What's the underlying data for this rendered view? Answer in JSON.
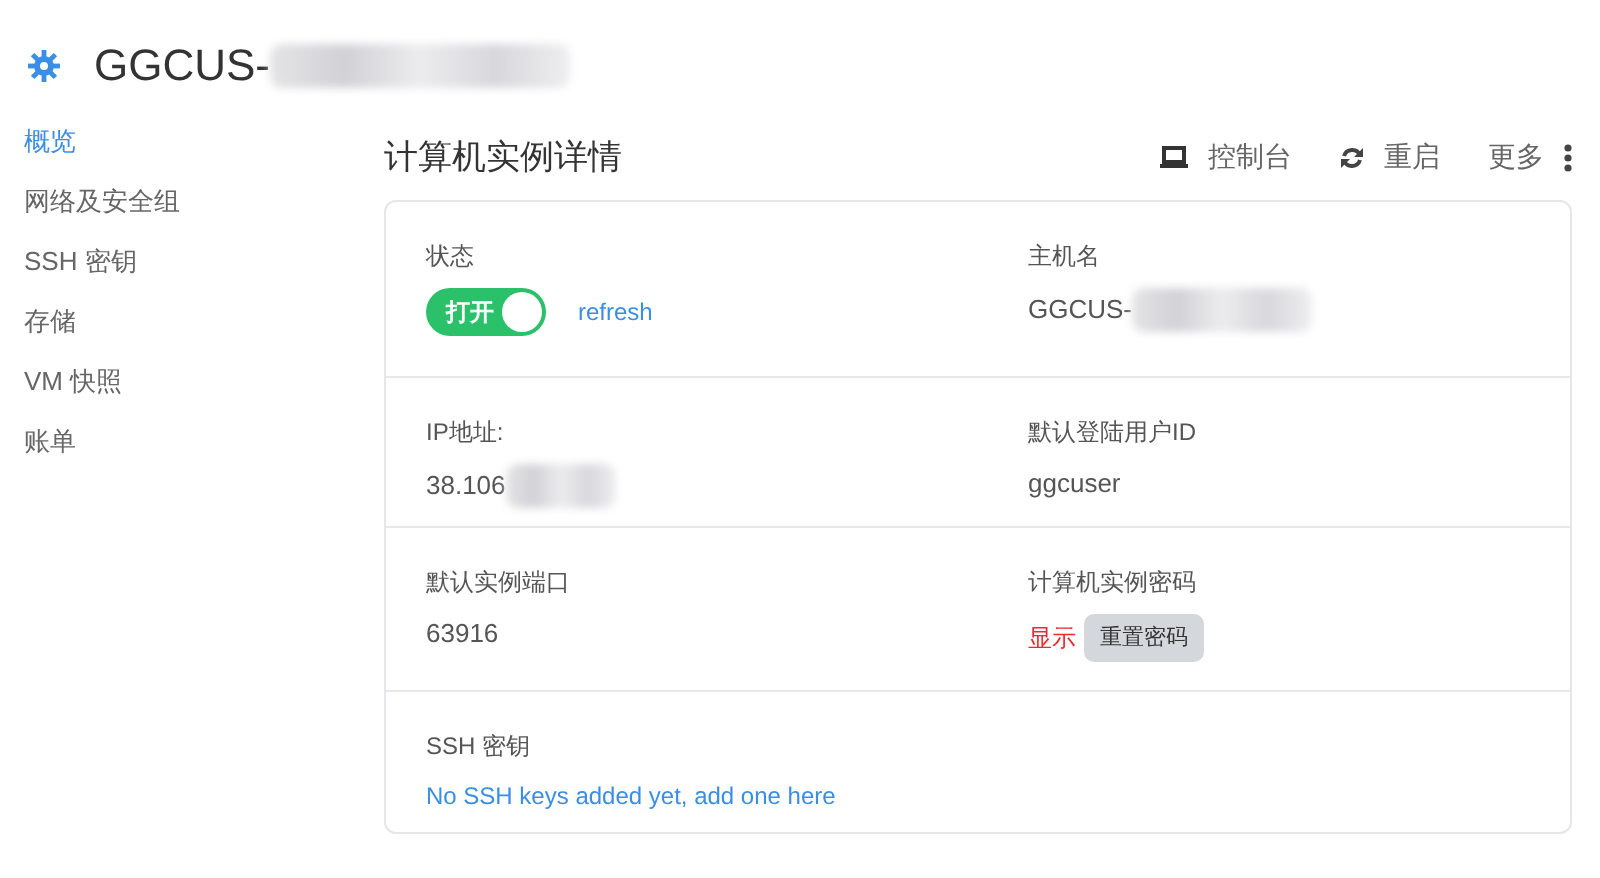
{
  "header": {
    "title": "GGCUS-",
    "redacted": true
  },
  "sidebar": {
    "items": [
      {
        "label": "概览",
        "selected": true
      },
      {
        "label": "网络及安全组",
        "selected": false
      },
      {
        "label": "SSH 密钥",
        "selected": false
      },
      {
        "label": "存储",
        "selected": false
      },
      {
        "label": "VM 快照",
        "selected": false
      },
      {
        "label": "账单",
        "selected": false
      }
    ]
  },
  "main": {
    "title": "计算机实例详情",
    "actions": [
      {
        "kind": "console",
        "label": "控制台"
      },
      {
        "kind": "restart",
        "label": "重启"
      },
      {
        "kind": "more",
        "label": "更多"
      }
    ]
  },
  "rows": [
    {
      "cells": [
        {
          "kind": "status",
          "label": "状态",
          "toggle_label": "打开",
          "on": true,
          "link": "refresh"
        },
        {
          "kind": "text",
          "label": "主机名",
          "value": "GGCUS-",
          "redacted": true
        }
      ]
    },
    {
      "cells": [
        {
          "kind": "text",
          "label": "IP地址:",
          "value": "38.106",
          "redacted": true
        },
        {
          "kind": "text",
          "label": "默认登陆用户ID",
          "value": "ggcuser",
          "redacted": false
        }
      ]
    },
    {
      "cells": [
        {
          "kind": "text",
          "label": "默认实例端口",
          "value": "63916",
          "redacted": false
        },
        {
          "kind": "password",
          "label": "计算机实例密码",
          "show_link": "显示",
          "button": "重置密码"
        }
      ]
    },
    {
      "cells": [
        {
          "kind": "link",
          "label": "SSH 密钥",
          "link": "No SSH keys added yet, add one here"
        }
      ]
    }
  ]
}
